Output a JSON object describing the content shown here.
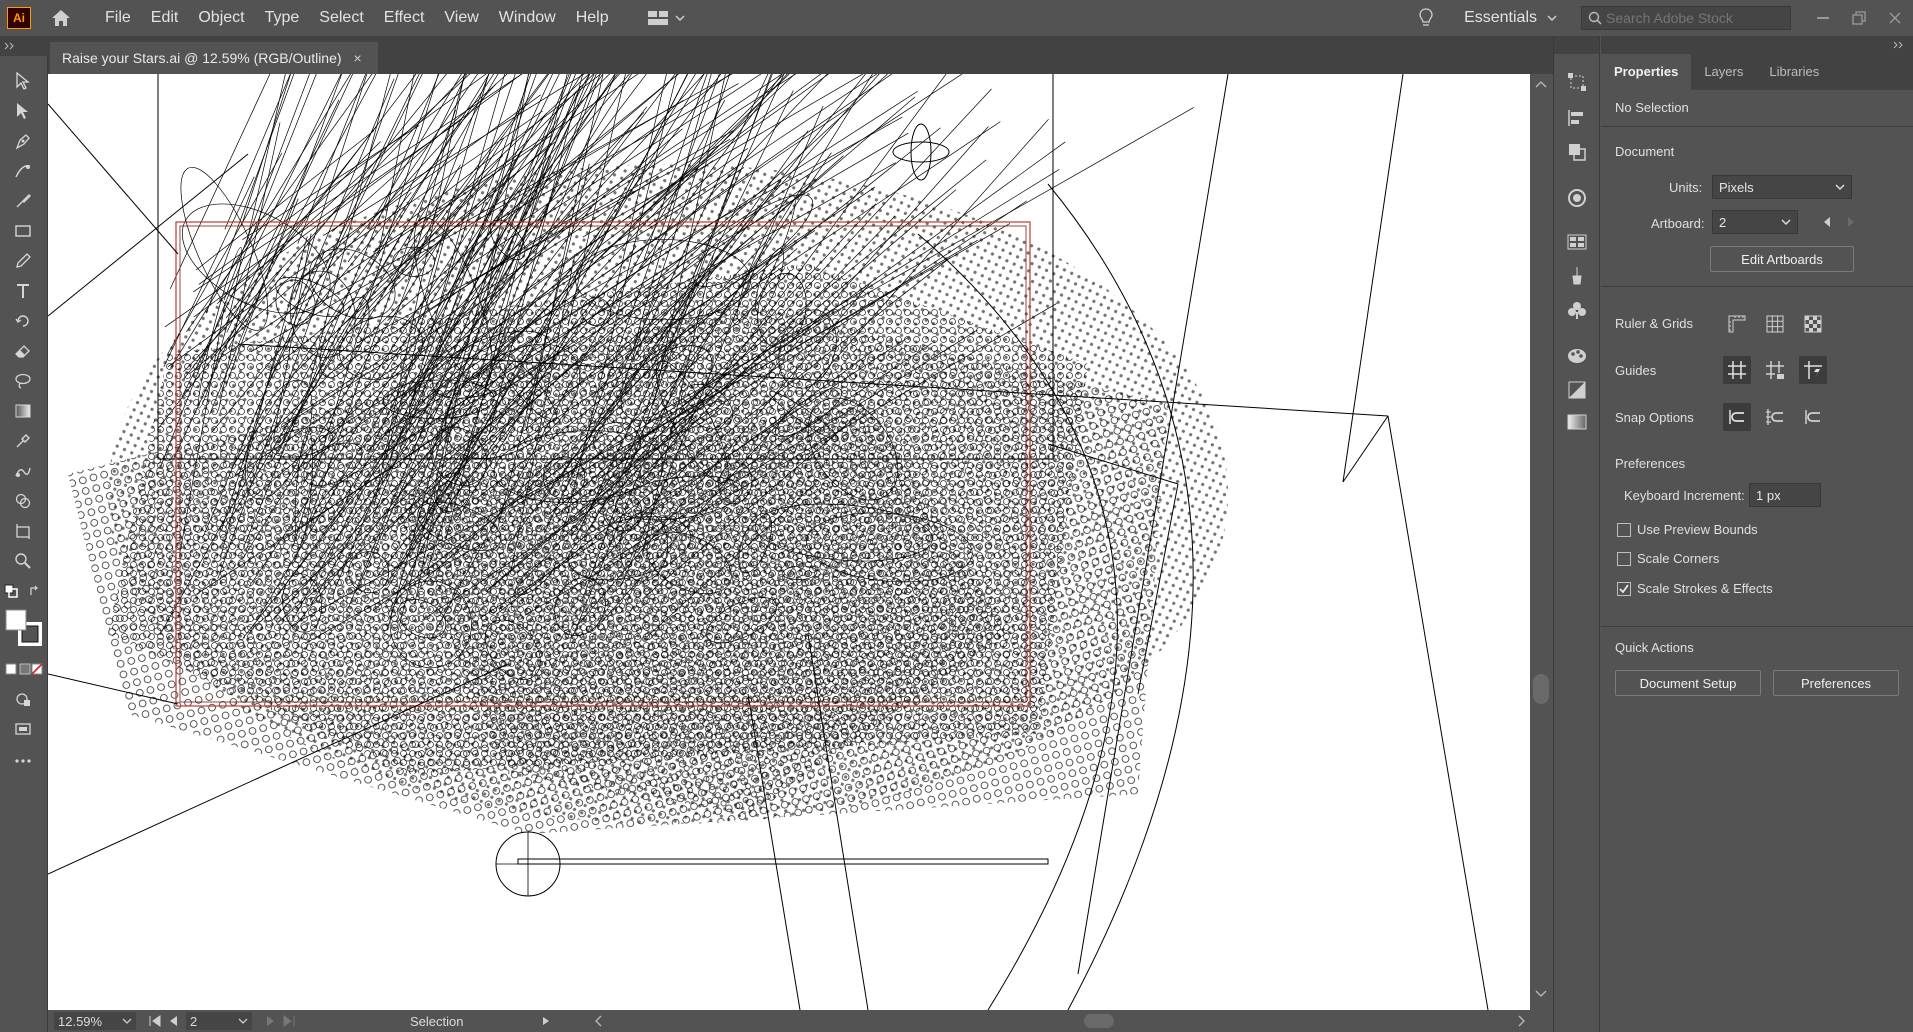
{
  "app": {
    "logo": "Ai"
  },
  "menu": [
    "File",
    "Edit",
    "Object",
    "Type",
    "Select",
    "Effect",
    "View",
    "Window",
    "Help"
  ],
  "workspace": {
    "label": "Essentials"
  },
  "stock_search": {
    "placeholder": "Search Adobe Stock"
  },
  "document_tab": {
    "title": "Raise your Stars.ai @ 12.59% (RGB/Outline)",
    "close": "×"
  },
  "status_bar": {
    "zoom": "12.59%",
    "artboard": "2",
    "tool": "Selection"
  },
  "properties_panel": {
    "tabs": [
      "Properties",
      "Layers",
      "Libraries"
    ],
    "selection": "No Selection",
    "document_heading": "Document",
    "units_label": "Units:",
    "units_value": "Pixels",
    "artboard_label": "Artboard:",
    "artboard_value": "2",
    "edit_artboards": "Edit Artboards",
    "ruler_grids": "Ruler & Grids",
    "guides": "Guides",
    "snap_options": "Snap Options",
    "preferences_heading": "Preferences",
    "keyboard_increment_label": "Keyboard Increment:",
    "keyboard_increment_value": "1 px",
    "use_preview_bounds": "Use Preview Bounds",
    "scale_corners": "Scale Corners",
    "scale_strokes_effects": "Scale Strokes & Effects",
    "quick_actions": "Quick Actions",
    "document_setup": "Document Setup",
    "preferences_button": "Preferences"
  },
  "checkbox_states": {
    "use_preview_bounds": false,
    "scale_corners": false,
    "scale_strokes_effects": true
  },
  "colors": {
    "accent_logo": "#ff9a00",
    "artboard_border": "#c0392b",
    "panel_bg": "#535353"
  }
}
